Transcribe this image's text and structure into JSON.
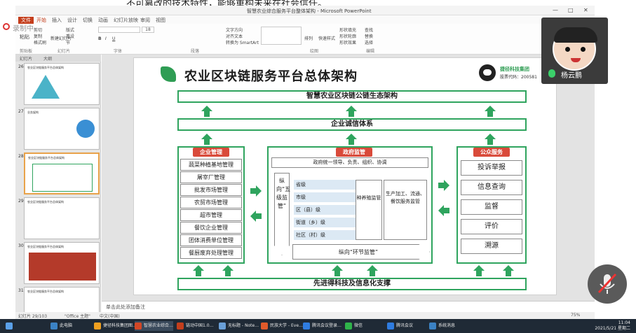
{
  "caption": "不可篡改的技术特性，能够重构未来在社会信任。",
  "window": {
    "title": "智慧农业综合服务平台整体架构 - Microsoft PowerPoint",
    "controls": [
      "—",
      "□",
      "✕"
    ]
  },
  "ribbon": {
    "tabs": [
      "文件",
      "开始",
      "插入",
      "设计",
      "切换",
      "动画",
      "幻灯片放映",
      "审阅",
      "视图"
    ],
    "active_tab": "开始",
    "groups": [
      "剪贴板",
      "幻灯片",
      "字体",
      "段落",
      "绘图",
      "编辑"
    ],
    "buttons": {
      "paste": "粘贴",
      "new_slide": "新建幻灯片",
      "layout": "版式",
      "reset": "重设",
      "section": "节",
      "arrange": "排列",
      "quick_styles": "快速样式",
      "find": "查找",
      "replace": "替换",
      "select": "选择",
      "text_direction": "文字方向",
      "align_text": "对齐文本",
      "convert_smartart": "转换为 SmartArt",
      "shape_fill": "形状填充",
      "shape_outline": "形状轮廓",
      "shape_effects": "形状效果",
      "format_painter": "格式刷",
      "cut": "剪切",
      "copy": "复制"
    },
    "font_size_value": "18"
  },
  "thumbs": {
    "tabs": [
      "幻灯片",
      "大纲"
    ],
    "slides": [
      {
        "num": "26",
        "title": "农业区块链服务平台总体架构"
      },
      {
        "num": "27",
        "title": "业务架构"
      },
      {
        "num": "28",
        "title": "农业区块链服务平台总体架构"
      },
      {
        "num": "29",
        "title": "农业区块链服务平台总体架构"
      },
      {
        "num": "30",
        "title": "农业区块链服务平台总体架构"
      },
      {
        "num": "31",
        "title": "农业区块链服务平台总体架构"
      }
    ],
    "selected_index": 2
  },
  "slide": {
    "title": "农业区块链服务平台总体架构",
    "company_name": "捷径科技集团",
    "company_code": "股票代码：200581",
    "top_bar": "智慧农业区块链公链生态架构",
    "credit_bar": "企业诚信体系",
    "bottom_bar": "先进得科技及信息化支撑",
    "left": {
      "header": "企业管理",
      "items": [
        "蔬菜种植基地管理",
        "屠宰厂管理",
        "批发市场管理",
        "农贸市场管理",
        "超市管理",
        "餐饮企业管理",
        "团体消费单位管理",
        "餐厨废弃处理管理"
      ]
    },
    "middle": {
      "header": "政府监管",
      "subtitle": "政府统一领导、负责、组织、协调",
      "vertical_label": "纵向“五级监管”",
      "levels": [
        "省级",
        "市级",
        "区（县）级",
        "街道（乡）级",
        "社区（村）级"
      ],
      "col1": "种养殖监管",
      "col2": "生产加工、流通、餐饮服务监管",
      "horizontal_label": "纵向“环节监管”"
    },
    "right": {
      "header": "公众服务",
      "items": [
        "投诉举报",
        "信息查询",
        "监督",
        "评价",
        "溯源"
      ]
    }
  },
  "notes": {
    "placeholder": "单击此处添加备注"
  },
  "statusbar": {
    "slide_info": "幻灯片 29/103",
    "theme": "\"Office 主题\"",
    "language": "中文(中国)",
    "zoom": "75%"
  },
  "taskbar": {
    "apps": [
      {
        "label": "此电脑",
        "color": "#3b82c4"
      },
      {
        "label": "捷径科技集团图…",
        "color": "#f0a020"
      },
      {
        "label": "智慧农业综合…",
        "color": "#d24726"
      },
      {
        "label": "链动中国1.0…",
        "color": "#c43e1c"
      },
      {
        "label": "无标题 - Note…",
        "color": "#6aa0d8"
      },
      {
        "label": "民族大学 - Eve…",
        "color": "#e05a2a"
      },
      {
        "label": "腾讯会议登录…",
        "color": "#2f7ce0"
      },
      {
        "label": "微信",
        "color": "#2fb34a"
      },
      {
        "label": "腾讯会议",
        "color": "#2f7ce0"
      },
      {
        "label": "系统消息",
        "color": "#3b82c4"
      }
    ],
    "time": "11:04",
    "date": "2021/5/21 星期二"
  },
  "webcam": {
    "name": "杨云鹏"
  },
  "recorder": {
    "label": "录制中"
  },
  "colors": {
    "accent_green": "#2fa45e",
    "header_red": "#d94a3a",
    "level_blue": "#dce9f4",
    "ppt_orange": "#c43e1c"
  }
}
